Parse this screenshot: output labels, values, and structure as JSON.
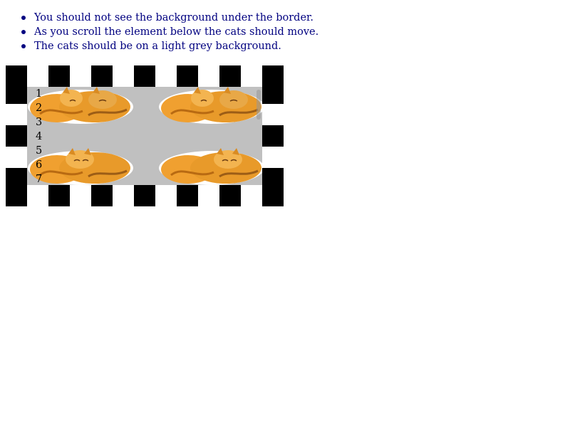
{
  "notes": [
    "You should not see the background under the border.",
    "As you scroll the element below the cats should move.",
    "The cats should be on a light grey background."
  ],
  "scroll_lines": [
    "1",
    "2",
    "3",
    "4",
    "5",
    "6",
    "7"
  ],
  "colors": {
    "text": "#000080",
    "border_dark": "#000000",
    "border_light": "#ffffff",
    "scroll_background": "#c0c0c0"
  }
}
